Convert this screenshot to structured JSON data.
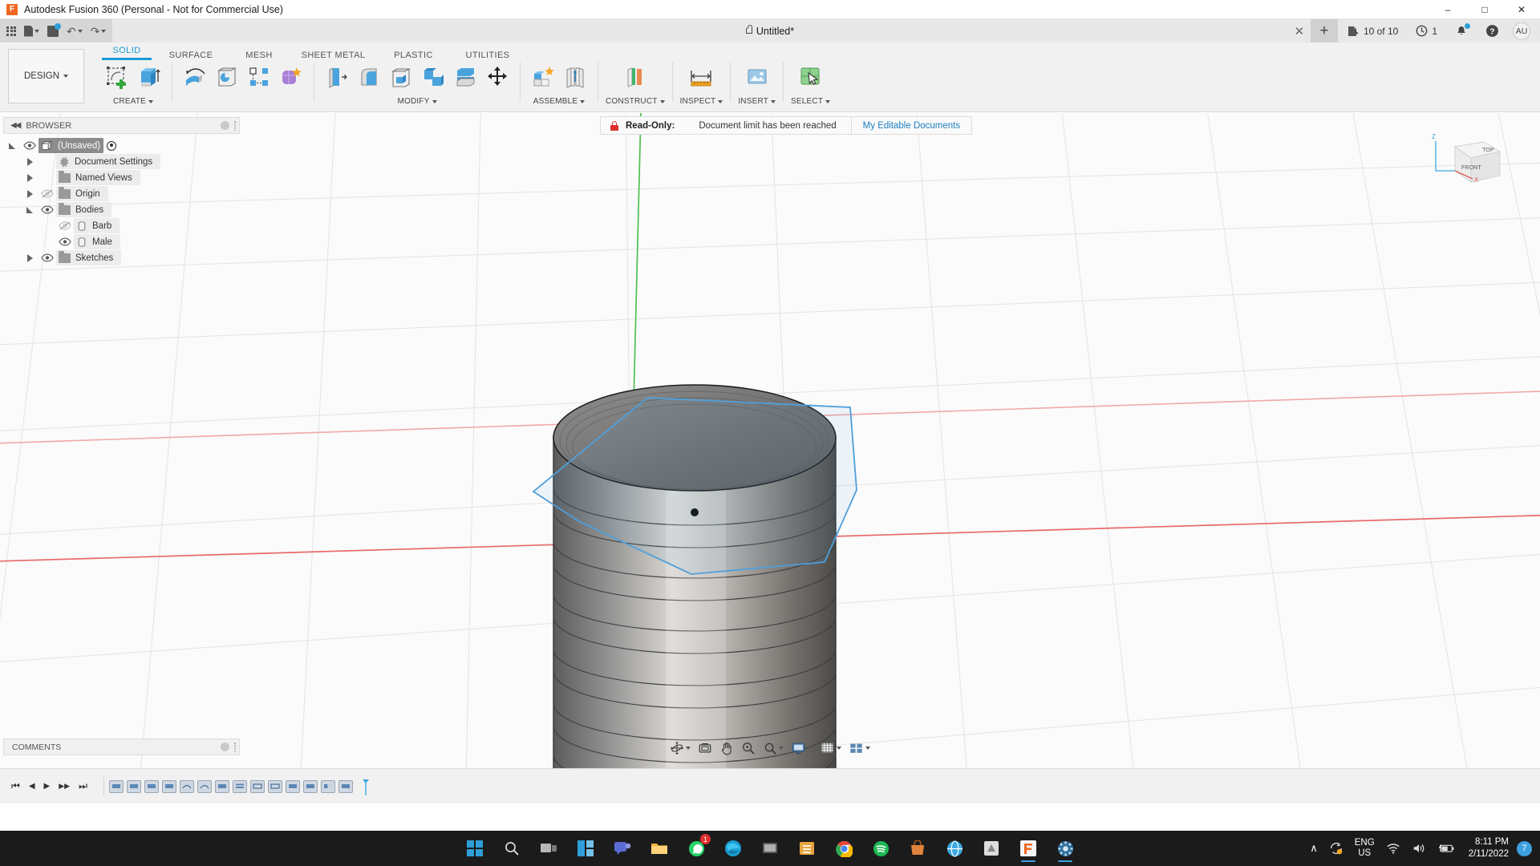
{
  "window": {
    "title": "Autodesk Fusion 360 (Personal - Not for Commercial Use)",
    "logo_letter": "F",
    "minimize": "–",
    "maximize": "□",
    "close": "✕"
  },
  "quick_access": {
    "app_grid": "app-grid-icon",
    "new_doc": "file-icon",
    "save": "save-icon",
    "undo": "↶",
    "redo": "↷"
  },
  "document": {
    "name": "Untitled*",
    "lock": "lock-icon"
  },
  "top_right": {
    "close_tab": "✕",
    "new_tab": "+",
    "extension_count": "10 of 10",
    "job_count": "1",
    "notifications_icon": "bell-icon",
    "help_icon": "help-icon",
    "avatar_initials": "AU"
  },
  "ribbon": {
    "workspace": "DESIGN",
    "tabs": [
      {
        "label": "SOLID",
        "active": true
      },
      {
        "label": "SURFACE",
        "active": false
      },
      {
        "label": "MESH",
        "active": false
      },
      {
        "label": "SHEET METAL",
        "active": false
      },
      {
        "label": "PLASTIC",
        "active": false
      },
      {
        "label": "UTILITIES",
        "active": false
      }
    ],
    "panels": [
      {
        "label": "CREATE",
        "has_caret": true
      },
      {
        "label": "MODIFY",
        "has_caret": true
      },
      {
        "label": "ASSEMBLE",
        "has_caret": true
      },
      {
        "label": "CONSTRUCT",
        "has_caret": true
      },
      {
        "label": "INSPECT",
        "has_caret": true
      },
      {
        "label": "INSERT",
        "has_caret": true
      },
      {
        "label": "SELECT",
        "has_caret": true
      }
    ]
  },
  "browser": {
    "title": "BROWSER",
    "collapse": "◀◀",
    "tree": [
      {
        "label": "(Unsaved)",
        "indent": 0,
        "expander": "open",
        "eye": "visible",
        "icon": "document-cube-icon",
        "selected": true,
        "radio": true
      },
      {
        "label": "Document Settings",
        "indent": 1,
        "expander": "closed",
        "eye": "none",
        "icon": "gear-icon",
        "selected": false,
        "radio": false
      },
      {
        "label": "Named Views",
        "indent": 1,
        "expander": "closed",
        "eye": "none",
        "icon": "folder-icon",
        "selected": false,
        "radio": false
      },
      {
        "label": "Origin",
        "indent": 1,
        "expander": "closed",
        "eye": "hidden",
        "icon": "folder-icon",
        "selected": false,
        "radio": false
      },
      {
        "label": "Bodies",
        "indent": 1,
        "expander": "open",
        "eye": "visible",
        "icon": "folder-icon",
        "selected": false,
        "radio": false
      },
      {
        "label": "Barb",
        "indent": 2,
        "expander": "none",
        "eye": "hidden",
        "icon": "body-icon",
        "selected": false,
        "radio": false
      },
      {
        "label": "Male",
        "indent": 2,
        "expander": "none",
        "eye": "visible",
        "icon": "body-icon",
        "selected": false,
        "radio": false
      },
      {
        "label": "Sketches",
        "indent": 1,
        "expander": "closed",
        "eye": "visible",
        "icon": "folder-icon",
        "selected": false,
        "radio": false
      }
    ]
  },
  "read_only_banner": {
    "lock_icon": "red-lock-icon",
    "label": "Read-Only:",
    "message": "Document limit has been reached",
    "link": "My Editable Documents",
    "lock_color": "#e03030",
    "link_color": "#1b7ec2"
  },
  "viewcube": {
    "top": "TOP",
    "front": "FRONT",
    "axis_z": "Z",
    "axis_x": "X"
  },
  "comments": {
    "title": "COMMENTS"
  },
  "navbar": {
    "items": [
      {
        "name": "orbit-icon",
        "caret": true
      },
      {
        "name": "look-at-icon",
        "caret": false
      },
      {
        "name": "pan-hand-icon",
        "caret": false
      },
      {
        "name": "zoom-icon",
        "caret": false
      },
      {
        "name": "zoom-window-icon",
        "caret": true
      },
      {
        "name": "display-settings-icon",
        "caret": true
      },
      {
        "name": "grid-snaps-icon",
        "caret": true
      },
      {
        "name": "viewports-icon",
        "caret": true
      }
    ]
  },
  "timeline": {
    "playback": [
      "⏮",
      "◀",
      "▶",
      "▶▶",
      "⏭"
    ],
    "feature_count": 14
  },
  "taskbar": {
    "apps": [
      {
        "name": "start-icon",
        "active": false
      },
      {
        "name": "search-icon",
        "active": false
      },
      {
        "name": "task-view-icon",
        "active": false
      },
      {
        "name": "widgets-icon",
        "active": false
      },
      {
        "name": "teams-icon",
        "active": false
      },
      {
        "name": "file-explorer-icon",
        "active": false
      },
      {
        "name": "whatsapp-icon",
        "active": false,
        "badge": "1"
      },
      {
        "name": "edge-icon",
        "active": false
      },
      {
        "name": "media-player-icon",
        "active": false
      },
      {
        "name": "excel-icon",
        "active": false
      },
      {
        "name": "chrome-icon",
        "active": false
      },
      {
        "name": "spotify-icon",
        "active": false
      },
      {
        "name": "store-icon",
        "active": false
      },
      {
        "name": "browser-icon",
        "active": false
      },
      {
        "name": "autodesk-icon",
        "active": false
      },
      {
        "name": "fusion360-icon",
        "active": true
      },
      {
        "name": "settings-icon",
        "active": true
      }
    ],
    "tray": {
      "chevron": "∧",
      "sync_icon": "onedrive-sync-icon",
      "language_line1": "ENG",
      "language_line2": "US",
      "wifi_icon": "wifi-icon",
      "volume_icon": "volume-icon",
      "battery_icon": "battery-charging-icon",
      "time": "8:11 PM",
      "date": "2/11/2022",
      "notification_count": "7"
    }
  },
  "model": {
    "description": "3D threaded cylindrical body shown in grey shaded view with blue highlighted sketch polygon on top face",
    "sketch_color": "#5aa9e0",
    "body_color": "#787878"
  }
}
